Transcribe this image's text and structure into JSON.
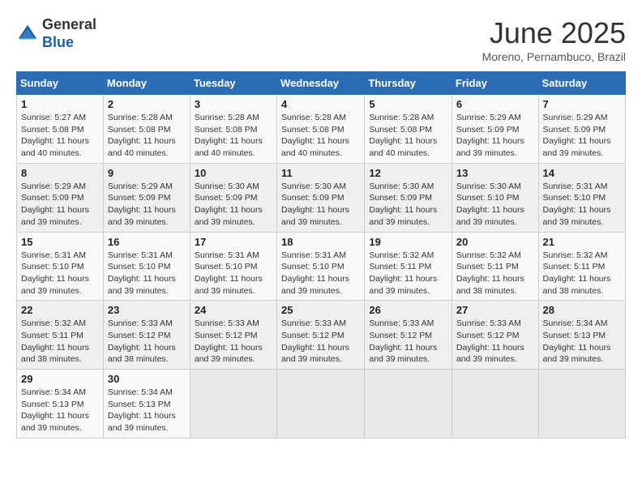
{
  "header": {
    "logo_line1": "General",
    "logo_line2": "Blue",
    "month": "June 2025",
    "location": "Moreno, Pernambuco, Brazil"
  },
  "days_of_week": [
    "Sunday",
    "Monday",
    "Tuesday",
    "Wednesday",
    "Thursday",
    "Friday",
    "Saturday"
  ],
  "weeks": [
    [
      {
        "day": "1",
        "info": "Sunrise: 5:27 AM\nSunset: 5:08 PM\nDaylight: 11 hours\nand 40 minutes."
      },
      {
        "day": "2",
        "info": "Sunrise: 5:28 AM\nSunset: 5:08 PM\nDaylight: 11 hours\nand 40 minutes."
      },
      {
        "day": "3",
        "info": "Sunrise: 5:28 AM\nSunset: 5:08 PM\nDaylight: 11 hours\nand 40 minutes."
      },
      {
        "day": "4",
        "info": "Sunrise: 5:28 AM\nSunset: 5:08 PM\nDaylight: 11 hours\nand 40 minutes."
      },
      {
        "day": "5",
        "info": "Sunrise: 5:28 AM\nSunset: 5:08 PM\nDaylight: 11 hours\nand 40 minutes."
      },
      {
        "day": "6",
        "info": "Sunrise: 5:29 AM\nSunset: 5:09 PM\nDaylight: 11 hours\nand 39 minutes."
      },
      {
        "day": "7",
        "info": "Sunrise: 5:29 AM\nSunset: 5:09 PM\nDaylight: 11 hours\nand 39 minutes."
      }
    ],
    [
      {
        "day": "8",
        "info": "Sunrise: 5:29 AM\nSunset: 5:09 PM\nDaylight: 11 hours\nand 39 minutes."
      },
      {
        "day": "9",
        "info": "Sunrise: 5:29 AM\nSunset: 5:09 PM\nDaylight: 11 hours\nand 39 minutes."
      },
      {
        "day": "10",
        "info": "Sunrise: 5:30 AM\nSunset: 5:09 PM\nDaylight: 11 hours\nand 39 minutes."
      },
      {
        "day": "11",
        "info": "Sunrise: 5:30 AM\nSunset: 5:09 PM\nDaylight: 11 hours\nand 39 minutes."
      },
      {
        "day": "12",
        "info": "Sunrise: 5:30 AM\nSunset: 5:09 PM\nDaylight: 11 hours\nand 39 minutes."
      },
      {
        "day": "13",
        "info": "Sunrise: 5:30 AM\nSunset: 5:10 PM\nDaylight: 11 hours\nand 39 minutes."
      },
      {
        "day": "14",
        "info": "Sunrise: 5:31 AM\nSunset: 5:10 PM\nDaylight: 11 hours\nand 39 minutes."
      }
    ],
    [
      {
        "day": "15",
        "info": "Sunrise: 5:31 AM\nSunset: 5:10 PM\nDaylight: 11 hours\nand 39 minutes."
      },
      {
        "day": "16",
        "info": "Sunrise: 5:31 AM\nSunset: 5:10 PM\nDaylight: 11 hours\nand 39 minutes."
      },
      {
        "day": "17",
        "info": "Sunrise: 5:31 AM\nSunset: 5:10 PM\nDaylight: 11 hours\nand 39 minutes."
      },
      {
        "day": "18",
        "info": "Sunrise: 5:31 AM\nSunset: 5:10 PM\nDaylight: 11 hours\nand 39 minutes."
      },
      {
        "day": "19",
        "info": "Sunrise: 5:32 AM\nSunset: 5:11 PM\nDaylight: 11 hours\nand 39 minutes."
      },
      {
        "day": "20",
        "info": "Sunrise: 5:32 AM\nSunset: 5:11 PM\nDaylight: 11 hours\nand 38 minutes."
      },
      {
        "day": "21",
        "info": "Sunrise: 5:32 AM\nSunset: 5:11 PM\nDaylight: 11 hours\nand 38 minutes."
      }
    ],
    [
      {
        "day": "22",
        "info": "Sunrise: 5:32 AM\nSunset: 5:11 PM\nDaylight: 11 hours\nand 38 minutes."
      },
      {
        "day": "23",
        "info": "Sunrise: 5:33 AM\nSunset: 5:12 PM\nDaylight: 11 hours\nand 38 minutes."
      },
      {
        "day": "24",
        "info": "Sunrise: 5:33 AM\nSunset: 5:12 PM\nDaylight: 11 hours\nand 39 minutes."
      },
      {
        "day": "25",
        "info": "Sunrise: 5:33 AM\nSunset: 5:12 PM\nDaylight: 11 hours\nand 39 minutes."
      },
      {
        "day": "26",
        "info": "Sunrise: 5:33 AM\nSunset: 5:12 PM\nDaylight: 11 hours\nand 39 minutes."
      },
      {
        "day": "27",
        "info": "Sunrise: 5:33 AM\nSunset: 5:12 PM\nDaylight: 11 hours\nand 39 minutes."
      },
      {
        "day": "28",
        "info": "Sunrise: 5:34 AM\nSunset: 5:13 PM\nDaylight: 11 hours\nand 39 minutes."
      }
    ],
    [
      {
        "day": "29",
        "info": "Sunrise: 5:34 AM\nSunset: 5:13 PM\nDaylight: 11 hours\nand 39 minutes."
      },
      {
        "day": "30",
        "info": "Sunrise: 5:34 AM\nSunset: 5:13 PM\nDaylight: 11 hours\nand 39 minutes."
      },
      {
        "day": "",
        "info": ""
      },
      {
        "day": "",
        "info": ""
      },
      {
        "day": "",
        "info": ""
      },
      {
        "day": "",
        "info": ""
      },
      {
        "day": "",
        "info": ""
      }
    ]
  ]
}
